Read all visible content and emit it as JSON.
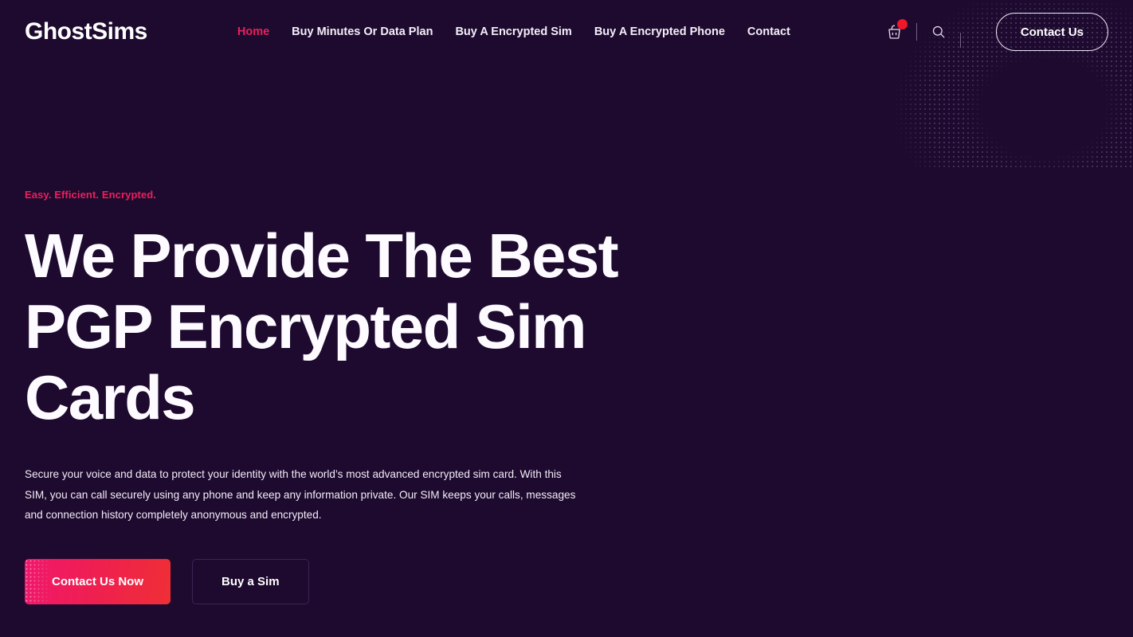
{
  "brand": {
    "name": "GhostSims"
  },
  "nav": {
    "items": [
      {
        "label": "Home",
        "active": true
      },
      {
        "label": "Buy Minutes Or Data Plan",
        "active": false
      },
      {
        "label": "Buy A Encrypted Sim",
        "active": false
      },
      {
        "label": "Buy A Encrypted Phone",
        "active": false
      },
      {
        "label": "Contact",
        "active": false
      }
    ]
  },
  "header": {
    "cart_icon": "shopping-cart-icon",
    "search_icon": "search-icon",
    "contact_button": "Contact Us"
  },
  "hero": {
    "eyebrow": "Easy. Efficient. Encrypted.",
    "title": "We Provide The Best PGP Encrypted Sim Cards",
    "paragraph": "Secure your voice and data to protect your identity with the world’s most advanced encrypted sim card. With this SIM, you can call securely using any phone and keep any information private.  Our SIM keeps your calls, messages and connection history completely anonymous and encrypted.",
    "primary_cta": "Contact Us Now",
    "secondary_cta": "Buy a Sim"
  },
  "colors": {
    "background": "#1d0a2e",
    "accent_pink": "#ec1f5d",
    "accent_red": "#ef2f35",
    "badge_red": "#f01728",
    "text_light": "#fdfbff"
  }
}
